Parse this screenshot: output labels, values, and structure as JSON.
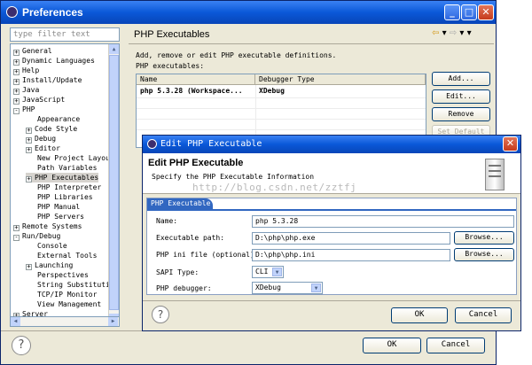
{
  "prefs": {
    "title": "Preferences",
    "filter_placeholder": "type filter text",
    "tree": [
      {
        "label": "General",
        "expander": "+",
        "indent": 0
      },
      {
        "label": "Dynamic Languages",
        "expander": "+",
        "indent": 0
      },
      {
        "label": "Help",
        "expander": "+",
        "indent": 0
      },
      {
        "label": "Install/Update",
        "expander": "+",
        "indent": 0
      },
      {
        "label": "Java",
        "expander": "+",
        "indent": 0
      },
      {
        "label": "JavaScript",
        "expander": "+",
        "indent": 0
      },
      {
        "label": "PHP",
        "expander": "-",
        "indent": 0
      },
      {
        "label": "Appearance",
        "expander": "",
        "indent": 1
      },
      {
        "label": "Code Style",
        "expander": "+",
        "indent": 1
      },
      {
        "label": "Debug",
        "expander": "+",
        "indent": 1
      },
      {
        "label": "Editor",
        "expander": "+",
        "indent": 1
      },
      {
        "label": "New Project Layout",
        "expander": "",
        "indent": 1
      },
      {
        "label": "Path Variables",
        "expander": "",
        "indent": 1
      },
      {
        "label": "PHP Executables",
        "expander": "+",
        "indent": 1,
        "selected": true
      },
      {
        "label": "PHP Interpreter",
        "expander": "",
        "indent": 1
      },
      {
        "label": "PHP Libraries",
        "expander": "",
        "indent": 1
      },
      {
        "label": "PHP Manual",
        "expander": "",
        "indent": 1
      },
      {
        "label": "PHP Servers",
        "expander": "",
        "indent": 1
      },
      {
        "label": "Remote Systems",
        "expander": "+",
        "indent": 0
      },
      {
        "label": "Run/Debug",
        "expander": "-",
        "indent": 0
      },
      {
        "label": "Console",
        "expander": "",
        "indent": 1
      },
      {
        "label": "External Tools",
        "expander": "",
        "indent": 1
      },
      {
        "label": "Launching",
        "expander": "+",
        "indent": 1
      },
      {
        "label": "Perspectives",
        "expander": "",
        "indent": 1
      },
      {
        "label": "String Substitutio",
        "expander": "",
        "indent": 1
      },
      {
        "label": "TCP/IP Monitor",
        "expander": "",
        "indent": 1
      },
      {
        "label": "View Management",
        "expander": "",
        "indent": 1
      },
      {
        "label": "Server",
        "expander": "+",
        "indent": 0
      }
    ],
    "page": {
      "title": "PHP Executables",
      "description": "Add, remove or edit PHP executable definitions.",
      "list_label": "PHP executables:",
      "columns": [
        "Name",
        "Debugger Type"
      ],
      "rows": [
        {
          "name": "php 5.3.28 (Workspace...",
          "debugger": "XDebug"
        }
      ],
      "buttons": [
        "Add...",
        "Edit...",
        "Remove",
        "Set Default"
      ]
    },
    "ok_label": "OK",
    "cancel_label": "Cancel",
    "help_glyph": "?"
  },
  "dialog": {
    "title": "Edit PHP Executable",
    "header_title": "Edit PHP Executable",
    "header_subtitle": "Specify the PHP Executable Information",
    "watermark": "http://blog.csdn.net/zztfj",
    "tab_label": "PHP Executable",
    "fields": {
      "name_label": "Name:",
      "name_value": "php 5.3.28",
      "exe_label": "Executable path:",
      "exe_value": "D:\\php\\php.exe",
      "ini_label": "PHP ini file (optional):",
      "ini_value": "D:\\php\\php.ini",
      "sapi_label": "SAPI Type:",
      "sapi_value": "CLI",
      "debugger_label": "PHP debugger:",
      "debugger_value": "XDebug"
    },
    "browse_label": "Browse...",
    "ok_label": "OK",
    "cancel_label": "Cancel",
    "help_glyph": "?"
  }
}
